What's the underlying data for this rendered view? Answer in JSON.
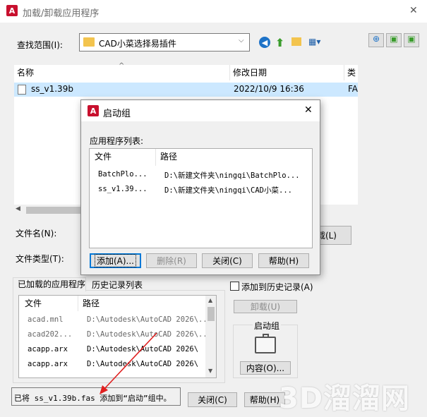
{
  "window": {
    "title": "加载/卸载应用程序",
    "close": "✕"
  },
  "lookin": {
    "label": "查找范围(I):",
    "folder": "CAD小菜选择易插件"
  },
  "file_list": {
    "columns": [
      "名称",
      "修改日期",
      "类型"
    ],
    "rows": [
      {
        "name": "ss_v1.39b",
        "date": "2022/10/9 16:36",
        "type": "FA"
      }
    ]
  },
  "filename_label": "文件名(N):",
  "filetype_label": "文件类型(T):",
  "load_button": "载(L)",
  "tabs": {
    "loaded": "已加载的应用程序",
    "history": "历史记录列表"
  },
  "add_history_label": "添加到历史记录(A)",
  "loaded_list": {
    "columns": [
      "文件",
      "路径"
    ],
    "rows": [
      {
        "file": "acad.mnl",
        "path": "D:\\Autodesk\\AutoCAD 2026\\..."
      },
      {
        "file": "acad202...",
        "path": "D:\\Autodesk\\AutoCAD 2026\\..."
      },
      {
        "file": "acapp.arx",
        "path": "D:\\Autodesk\\AutoCAD 2026\\"
      },
      {
        "file": "acapp.arx",
        "path": "D:\\Autodesk\\AutoCAD 2026\\"
      }
    ]
  },
  "unload_button": "卸载(U)",
  "startup_group": {
    "label": "启动组",
    "contents_button": "内容(O)..."
  },
  "status_text": "已将 ss_v1.39b.fas 添加到“启动”组中。",
  "close_button": "关闭(C)",
  "help_button": "帮助(H)",
  "watermark": "3D溜溜网",
  "dialog": {
    "title": "启动组",
    "list_label": "应用程序列表:",
    "columns": [
      "文件",
      "路径"
    ],
    "rows": [
      {
        "file": "BatchPlo...",
        "path": "D:\\新建文件夹\\ningqi\\BatchPlo..."
      },
      {
        "file": "ss_v1.39...",
        "path": "D:\\新建文件夹\\ningqi\\CAD小菜..."
      }
    ],
    "add_button": "添加(A)...",
    "remove_button": "删除(R)",
    "close_button": "关闭(C)",
    "help_button": "帮助(H)"
  }
}
